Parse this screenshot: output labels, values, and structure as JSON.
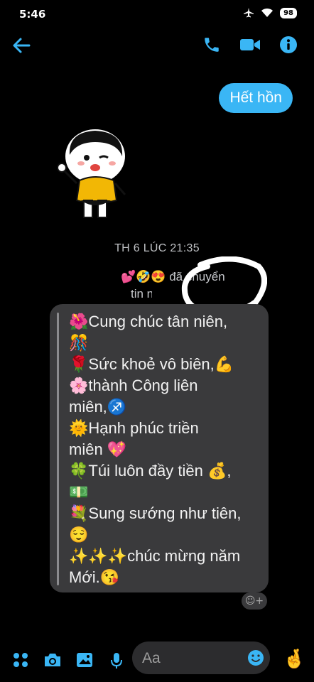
{
  "statusbar": {
    "time": "5:46",
    "battery": "98"
  },
  "messages": {
    "outgoing_text": "Hết hồn",
    "timestamp": "TH 6 LÚC 21:35",
    "forward_line1": "💕🤣😍 đã chuyển",
    "forward_line2": "tin nhắn",
    "forwarded_lines": [
      "🌺Cung chúc tân niên,",
      "🎊",
      "🌹Sức khoẻ vô biên,💪",
      "🌸thành Công liên",
      "miên,♐",
      "🌞Hạnh phúc triền",
      "miên 💖",
      "🍀Túi luôn đầy tiền 💰,",
      "💵",
      "💐Sung sướng như tiên,",
      "😌",
      "✨✨✨chúc mừng năm",
      "Mới.😘"
    ]
  },
  "composer": {
    "placeholder": "Aa"
  },
  "colors": {
    "accent": "#3ab6f5",
    "bubble_dark": "#3a3a3c"
  }
}
